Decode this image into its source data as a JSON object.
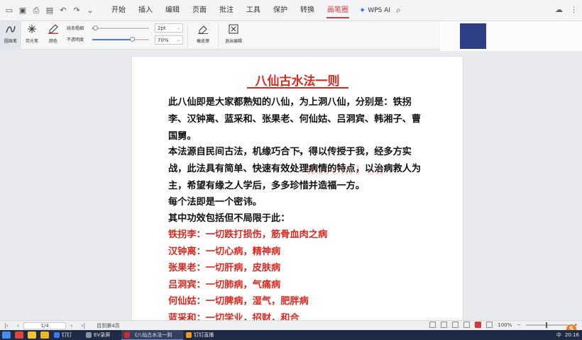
{
  "menu": {
    "items": [
      "开始",
      "插入",
      "编辑",
      "页面",
      "批注",
      "工具",
      "保护",
      "转换",
      "画笔圈"
    ],
    "active_index": 8,
    "wps_ai": "WPS AI"
  },
  "ribbon": {
    "tools": [
      {
        "label": "圆珠笔",
        "icon": "pen-icon"
      },
      {
        "label": "荧光笔",
        "icon": "highlighter-icon"
      },
      {
        "label": "颜色",
        "icon": "color-pen-icon"
      }
    ],
    "sliders": [
      {
        "label": "线条粗细",
        "value": 0.05
      },
      {
        "label": "不透明度",
        "value": 0.7
      }
    ],
    "selects": [
      {
        "value": "2pt"
      },
      {
        "value": "70%"
      }
    ],
    "eraser_label": "橡皮擦",
    "exit_label": "退出编辑",
    "accent": "#d23b3b",
    "color_swatch": "#2f3f86"
  },
  "document": {
    "title": "八仙古水法一则",
    "paragraphs": [
      "此八仙即是大家都熟知的八仙，为上洞八仙，分别是：铁拐李、汉钟离、蓝采和、张果老、何仙姑、吕洞宾、韩湘子、曹国舅。",
      "本法源自民间古法，机缘巧合下，得以传授于我，经多方实战，此法具有简单、快速有效处理病情的特点，以治病救人为主，希望有缘之人学后，多多珍惜并造福一方。",
      "每个法即是一个密讳。",
      "其中功效包括但不局限于此："
    ],
    "red_items": [
      "铁拐李：一切跌打损伤，筋骨血肉之病",
      "汉钟离：一切心病，精神病",
      "张果老：一切肝病，皮肤病",
      "吕洞宾：一切肺病，气痛病",
      "何仙姑：一切脾病，湿气，肥胖病",
      "蓝采和：一切学业，招财，和合"
    ],
    "watermark": "haveni1 cn",
    "title_color": "#d8281f"
  },
  "status": {
    "page": "1/4",
    "pages_text": "目到第4页",
    "zoom": "100%"
  },
  "taskbar": {
    "apps": [
      "钉钉",
      "EV录屏",
      "《八仙古水法一则",
      "钉钉直播"
    ],
    "active_index": 2,
    "time": "20:16",
    "ime": "中"
  }
}
